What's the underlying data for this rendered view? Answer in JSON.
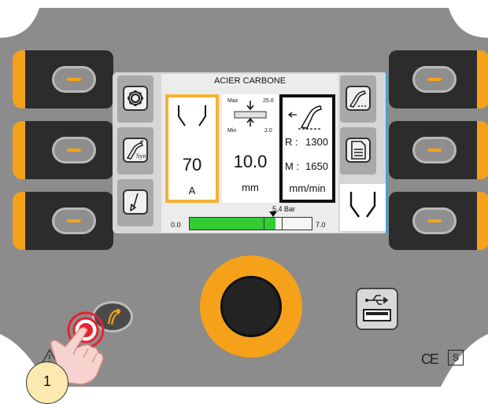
{
  "screen": {
    "title": "ACIER CARBONE",
    "current": {
      "value": "70",
      "unit": "A"
    },
    "thickness": {
      "value": "10.0",
      "unit": "mm",
      "max_label": "Max",
      "max_value": "25.0",
      "min_label": "Min",
      "min_value": "2.0"
    },
    "wire_speed": {
      "r_label": "R :",
      "r_value": "1300",
      "m_label": "M :",
      "m_value": "1650",
      "unit": "mm/min"
    },
    "gas_pressure": {
      "min": "0.0",
      "max": "7.0",
      "value_label": "5.4 Bar",
      "value": 5.4,
      "fill_fraction": 0.7
    },
    "syn_label": "Syn"
  },
  "step_badge": {
    "label": "1"
  },
  "marks": {
    "ce": "CE",
    "s": "S"
  },
  "colors": {
    "accent": "#f5a21a",
    "panel": "#8c8c8c",
    "green": "#33cc33",
    "highlight": "#f7b232"
  }
}
